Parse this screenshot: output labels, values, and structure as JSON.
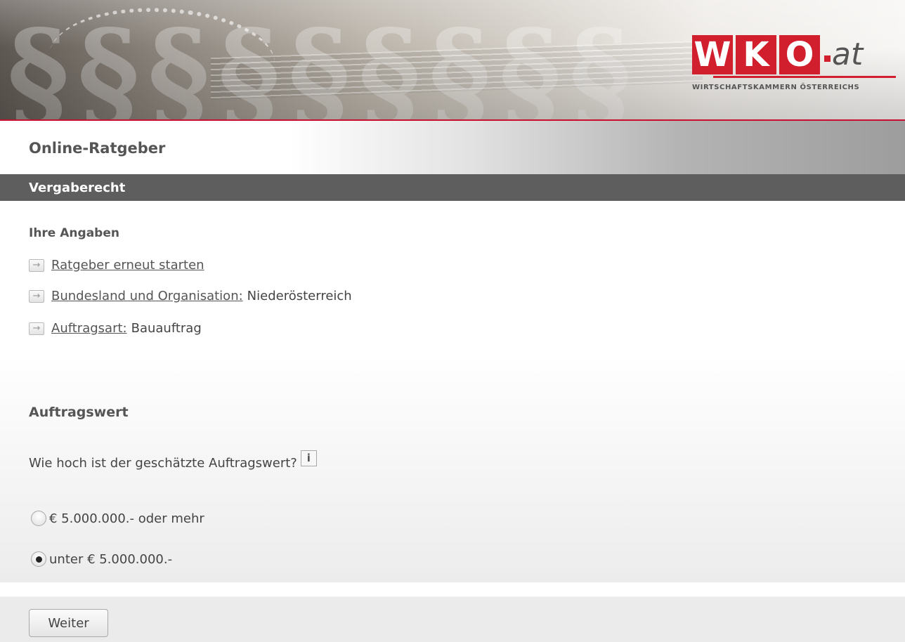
{
  "header": {
    "logo": {
      "letters": [
        "W",
        "K",
        "O"
      ],
      "suffix": "at",
      "subtitle": "WIRTSCHAFTSKAMMERN ÖSTERREICHS",
      "brand_color": "#d11f2e"
    }
  },
  "title": "Online-Ratgeber",
  "section": "Vergaberecht",
  "angaben": {
    "heading": "Ihre Angaben",
    "items": [
      {
        "link": "Ratgeber erneut starten",
        "value": ""
      },
      {
        "link": "Bundesland und Organisation:",
        "value": "Niederösterreich"
      },
      {
        "link": "Auftragsart:",
        "value": "Bauauftrag"
      }
    ]
  },
  "question_section": {
    "heading": "Auftragswert",
    "question": "Wie hoch ist der geschätzte Auftragswert?",
    "info_label": "i",
    "options": [
      {
        "label": "€ 5.000.000.- oder mehr",
        "selected": false
      },
      {
        "label": "unter € 5.000.000.-",
        "selected": true
      }
    ]
  },
  "footer": {
    "next_button": "Weiter"
  },
  "icons": {
    "link_arrow": "arrow-right-icon",
    "info": "info-icon"
  }
}
